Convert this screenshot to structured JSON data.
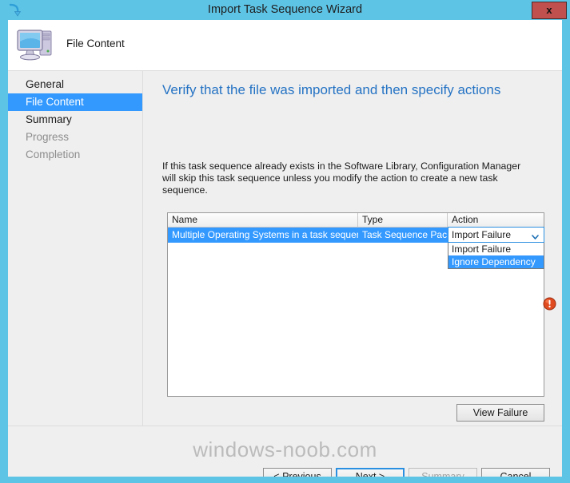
{
  "window": {
    "title": "Import Task Sequence Wizard",
    "close_label": "x",
    "icon": "import-arrow-icon",
    "titlebar_color": "#5ec4e6",
    "close_button_color": "#c0504d"
  },
  "header": {
    "icon": "computer-icon",
    "page_name": "File Content"
  },
  "sidebar": {
    "items": [
      {
        "label": "General",
        "state": "normal"
      },
      {
        "label": "File Content",
        "state": "selected"
      },
      {
        "label": "Summary",
        "state": "normal"
      },
      {
        "label": "Progress",
        "state": "disabled"
      },
      {
        "label": "Completion",
        "state": "disabled"
      }
    ],
    "selected_color": "#3399ff"
  },
  "content": {
    "heading": "Verify that the file was imported and then specify actions",
    "heading_color": "#2573c4",
    "description": "If this task sequence already exists in the Software Library, Configuration Manager will skip this task sequence unless you modify the action to create a new task sequence."
  },
  "table": {
    "columns": [
      "Name",
      "Type",
      "Action"
    ],
    "rows": [
      {
        "name": "Multiple Operating Systems in a task sequence",
        "type": "Task Sequence Pac...",
        "action": "Import Failure",
        "selected": true
      }
    ]
  },
  "action_dropdown": {
    "value": "Import Failure",
    "expanded": true,
    "options": [
      {
        "label": "Import Failure",
        "highlighted": false
      },
      {
        "label": "Ignore Dependency",
        "highlighted": true
      }
    ]
  },
  "status": {
    "error_icon": "error-exclamation-icon",
    "error_icon_color": "#e04b20"
  },
  "buttons": {
    "view_failure": "View Failure",
    "previous": "< Previous",
    "next": "Next >",
    "summary": "Summary",
    "cancel": "Cancel"
  },
  "watermark": {
    "text": "windows-noob.com"
  }
}
